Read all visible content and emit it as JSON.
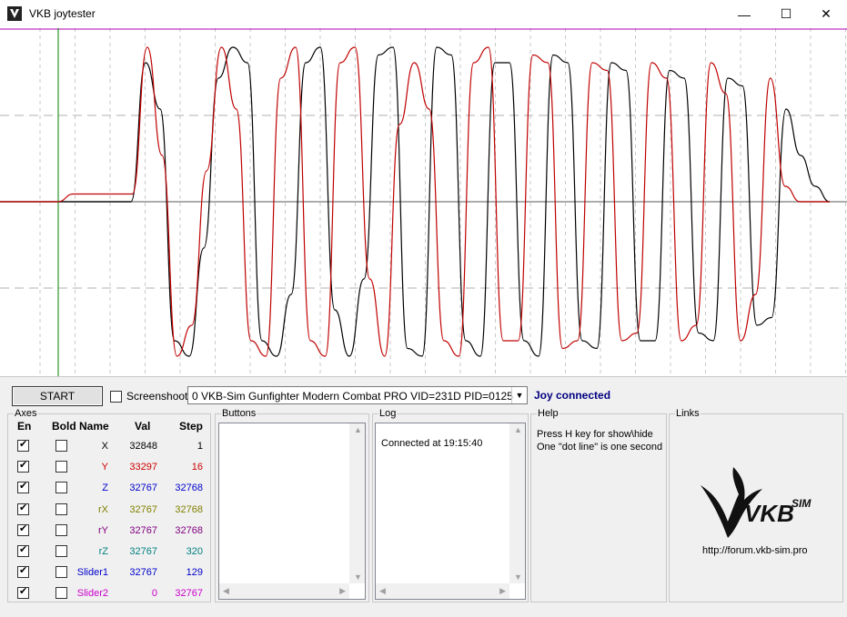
{
  "window": {
    "title": "VKB joytester",
    "icon": "vkb-logo-icon",
    "controls": {
      "minimize": "—",
      "maximize": "☐",
      "close": "✕"
    }
  },
  "chart_data": {
    "type": "line",
    "title": "",
    "xlabel": "",
    "ylabel": "",
    "grid": true,
    "series": [
      {
        "color": "#000000",
        "shape": "large oscillation, black",
        "values": [
          0,
          0,
          0,
          0,
          0,
          0,
          0.9,
          0.6,
          -0.9,
          -1.0,
          -0.3,
          0.8,
          1.0,
          0.9,
          -0.9,
          -1.0,
          -0.6,
          0.9,
          1.0,
          -0.7,
          -1.0,
          -0.5,
          0.95,
          1.0,
          -0.95,
          -1.0,
          1.0,
          0.95,
          -0.9,
          -1.0,
          0.9,
          0.9,
          -0.9,
          -1.0,
          0.95,
          0.9,
          -0.9,
          -0.95,
          0.9,
          0.85,
          -0.9,
          -0.9,
          0.85,
          0.8,
          -0.85,
          -0.9,
          0.8,
          0.75,
          -0.8,
          -0.75,
          0.6,
          0.3,
          0.1,
          0
        ]
      },
      {
        "color": "#c00000",
        "shape": "large oscillation, red, phase shifted",
        "values": [
          0,
          0.05,
          0.05,
          0.05,
          0.05,
          0.05,
          1.0,
          0.3,
          -1.0,
          -0.8,
          0.2,
          1.0,
          0.6,
          -0.9,
          -1.0,
          0.8,
          1.0,
          -0.9,
          -1.0,
          0.9,
          1.0,
          -0.5,
          -1.0,
          0.5,
          0.9,
          0.6,
          -0.9,
          -1.0,
          0.9,
          1.0,
          -0.9,
          -0.9,
          0.95,
          0.9,
          -0.95,
          -0.9,
          0.9,
          0.85,
          -0.9,
          -0.85,
          0.9,
          0.8,
          -0.9,
          -0.8,
          0.9,
          0.7,
          -0.9,
          -0.6,
          0.8,
          0.1,
          0,
          0,
          0
        ]
      }
    ]
  },
  "toolbar": {
    "start_label": "START",
    "screenshot_label": "Screenshoot",
    "screenshot_checked": false,
    "device": "0  VKB-Sim Gunfighter Modern Combat PRO  VID=231D PID=0125",
    "status": "Joy connected"
  },
  "axes": {
    "title": "Axes",
    "headers": {
      "en": "En",
      "bold": "Bold",
      "name": "Name",
      "val": "Val",
      "step": "Step"
    },
    "rows": [
      {
        "name": "X",
        "val": "32848",
        "step": "1",
        "color": "#000000",
        "en": true,
        "bold": false
      },
      {
        "name": "Y",
        "val": "33297",
        "step": "16",
        "color": "#cc0000",
        "en": true,
        "bold": false
      },
      {
        "name": "Z",
        "val": "32767",
        "step": "32768",
        "color": "#0000cc",
        "en": true,
        "bold": false
      },
      {
        "name": "rX",
        "val": "32767",
        "step": "32768",
        "color": "#808000",
        "en": true,
        "bold": false
      },
      {
        "name": "rY",
        "val": "32767",
        "step": "32768",
        "color": "#800080",
        "en": true,
        "bold": false
      },
      {
        "name": "rZ",
        "val": "32767",
        "step": "320",
        "color": "#008080",
        "en": true,
        "bold": false
      },
      {
        "name": "Slider1",
        "val": "32767",
        "step": "129",
        "color": "#0000cc",
        "en": true,
        "bold": false
      },
      {
        "name": "Slider2",
        "val": "0",
        "step": "32767",
        "color": "#cc00cc",
        "en": true,
        "bold": false
      }
    ]
  },
  "buttons_panel": {
    "title": "Buttons"
  },
  "log": {
    "title": "Log",
    "lines": [
      "Connected at 19:15:40"
    ]
  },
  "help": {
    "title": "Help",
    "lines": [
      "Press H key for show\\hide",
      "One \"dot line\" is one second"
    ]
  },
  "links": {
    "title": "Links",
    "logo": "vkb-sim-logo",
    "url": "http://forum.vkb-sim.pro"
  }
}
